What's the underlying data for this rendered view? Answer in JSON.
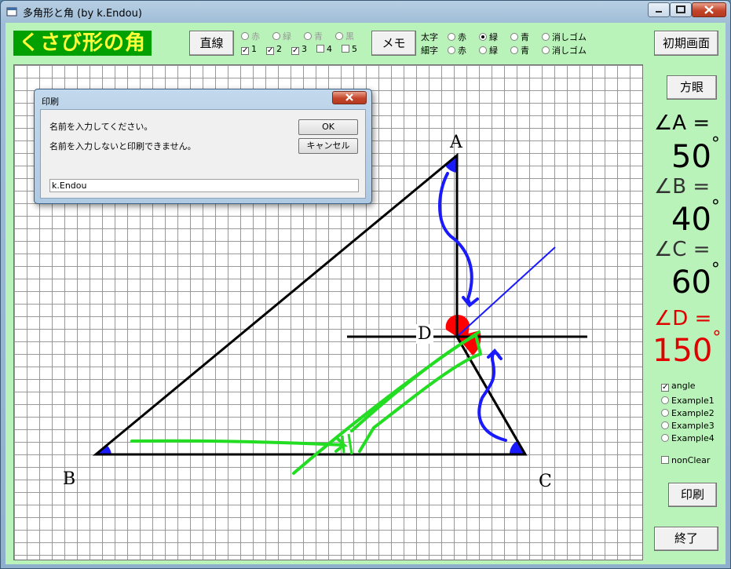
{
  "window": {
    "title": "多角形と角 (by k.Endou)"
  },
  "app": {
    "logo": "くさび形の角"
  },
  "toolbar": {
    "line_button": "直線",
    "memo_button": "メモ",
    "reset_button": "初期画面",
    "line_colors": [
      "赤",
      "緑",
      "青",
      "黒"
    ],
    "line_checks": [
      "1",
      "2",
      "3",
      "4",
      "5"
    ],
    "thick_label": "太字",
    "thin_label": "細字",
    "pen_colors": [
      "赤",
      "緑",
      "青"
    ],
    "eraser": "消しゴム"
  },
  "side": {
    "grid_button": "方眼",
    "angle_a_label": "∠A =",
    "angle_a_value": "50",
    "angle_b_label": "∠B =",
    "angle_b_value": "40",
    "angle_c_label": "∠C =",
    "angle_c_value": "60",
    "angle_d_label": "∠D =",
    "angle_d_value": "150",
    "degree_sign": "°",
    "angle_check": "angle",
    "examples": [
      "Example1",
      "Example2",
      "Example3",
      "Example4"
    ],
    "nonclear_check": "nonClear",
    "print_button": "印刷",
    "exit_button": "終了"
  },
  "diagram": {
    "label_a": "A",
    "label_b": "B",
    "label_c": "C",
    "label_d": "D"
  },
  "dialog": {
    "title": "印刷",
    "line1": "名前を入力してください。",
    "line2": "名前を入力しないと印刷できません。",
    "ok": "OK",
    "cancel": "キャンセル",
    "input_value": "k.Endou"
  },
  "colors": {
    "client_bg": "#b9f3b9",
    "logo_bg": "#00a000",
    "logo_text": "#ffff3a",
    "angle_d": "#e00000"
  }
}
